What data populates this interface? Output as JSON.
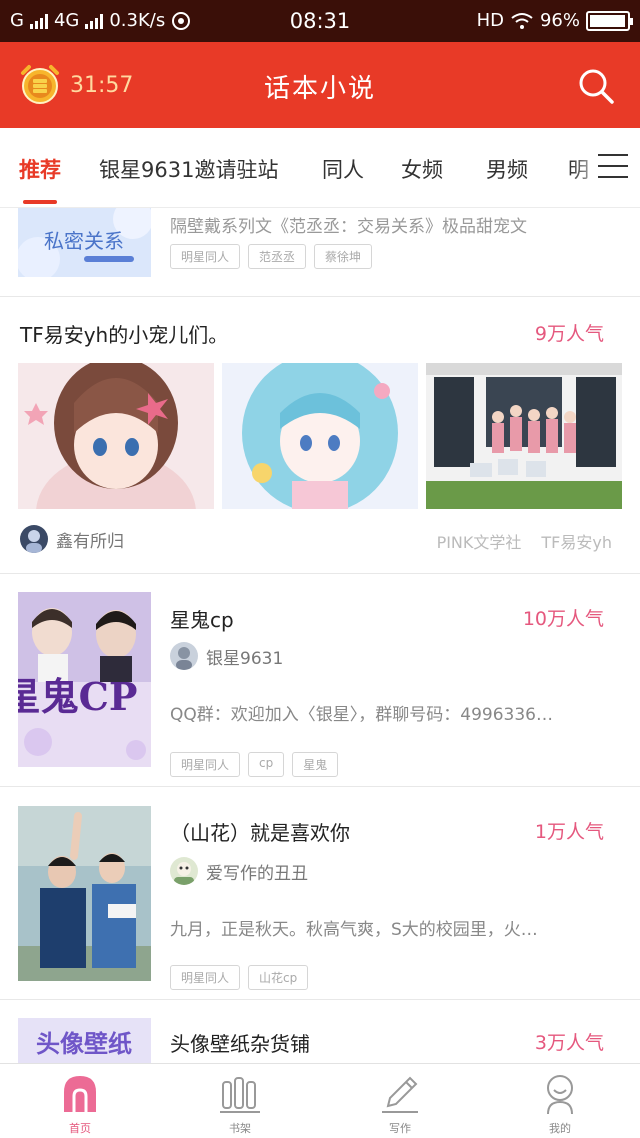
{
  "status_bar": {
    "carrier_left": "G",
    "network": "4G",
    "speed": "0.3K/s",
    "time": "08:31",
    "hd": "HD",
    "battery": "96%",
    "battery_level": 0.96
  },
  "header": {
    "timer": "31:57",
    "title": "话本小说"
  },
  "tabs": [
    {
      "label": "推荐",
      "active": true
    },
    {
      "label": "银星9631邀请驻站"
    },
    {
      "label": "同人"
    },
    {
      "label": "女频"
    },
    {
      "label": "男频"
    },
    {
      "label": "明"
    }
  ],
  "partial_card": {
    "cover_text": "私密关系",
    "desc": "隔壁戴系列文《范丞丞：交易关系》极品甜宠文",
    "tags": [
      "明星同人",
      "范丞丞",
      "蔡徐坤"
    ]
  },
  "collection": {
    "title": "TF易安yh的小宠儿们。",
    "popularity": "9万人气",
    "author": "鑫有所归",
    "tags": [
      "PINK文学社",
      "TF易安yh"
    ]
  },
  "books": [
    {
      "title": "星鬼cp",
      "popularity": "10万人气",
      "author": "银星9631",
      "desc": "QQ群：欢迎加入〈银星〉，群聊号码：4996336…",
      "tags": [
        "明星同人",
        "cp",
        "星鬼"
      ],
      "cover_text": "星鬼CP"
    },
    {
      "title": "（山花）就是喜欢你",
      "popularity": "1万人气",
      "author": "爱写作的丑丑",
      "desc": "九月，正是秋天。秋高气爽，S大的校园里，火…",
      "tags": [
        "明星同人",
        "山花cp"
      ]
    },
    {
      "title": "头像壁纸杂货铺",
      "popularity": "3万人气",
      "cover_text": "头像壁纸"
    }
  ],
  "bottom_nav": [
    {
      "label": "首页",
      "icon": "home-icon",
      "active": true
    },
    {
      "label": "书架",
      "icon": "bookshelf-icon"
    },
    {
      "label": "写作",
      "icon": "pen-icon"
    },
    {
      "label": "我的",
      "icon": "profile-icon"
    }
  ],
  "colors": {
    "header_red": "#e83a27",
    "status_bar": "#3a0f08",
    "popularity_pink": "#e5587e"
  }
}
